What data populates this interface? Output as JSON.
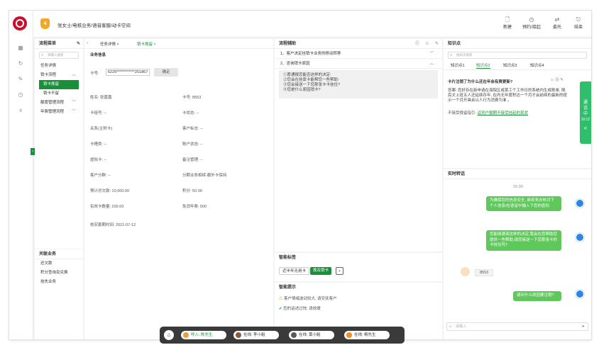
{
  "header": {
    "title": "张女士/电核业务/语音客服/动卡空间",
    "badge": "4",
    "actions": [
      {
        "label": "新建",
        "icon": "new-doc-icon"
      },
      {
        "label": "预约/接起",
        "icon": "clock-icon"
      },
      {
        "label": "委托",
        "icon": "delegate-icon"
      },
      {
        "label": "结束",
        "icon": "exit-icon"
      }
    ]
  },
  "process_menu": {
    "title": "流程菜单",
    "search_placeholder": "请输入搜索",
    "items": [
      "任务详情",
      "销卡流程",
      "销卡挽留",
      "销卡不留",
      "额度管理流程",
      "年费管理流程"
    ],
    "related_title": "关联业务",
    "related": [
      "还欠款",
      "积分查询及兑换",
      "挂失业务"
    ]
  },
  "tabs": {
    "items": [
      "任务详情",
      "销卡挽留"
    ]
  },
  "business": {
    "title": "业务信息",
    "card_label": "卡号:",
    "card_value": "6229************251867",
    "card_button": "确定",
    "fields": [
      {
        "l": "姓名: 张嘉嘉",
        "r": "卡号: 8553"
      },
      {
        "l": "卡组号: --",
        "r": "卡状态: --"
      },
      {
        "l": "关系(主附卡)",
        "r": "客户标志: --"
      },
      {
        "l": "卡槽类: --",
        "r": "账户状态: --"
      },
      {
        "l": "虚拟卡: --",
        "r": "备注管理: --"
      },
      {
        "l": "客户分群: --",
        "r": "分期业务相续-额外卡保持"
      },
      {
        "l": "预计总欠款: 10,000.00",
        "r": "积分: 50.00"
      },
      {
        "l": "有效卡数量: 200.00",
        "r": "免消年费: 500"
      }
    ],
    "expiry": "核实套期时间: 2021-07-12"
  },
  "flow": {
    "title": "流程辅助",
    "step1": "1、客户决定挂销卡业务的移动转移",
    "step2": "2、咨询销卡原因",
    "box_lines": [
      "①愿通报您能否这样的决定:",
      "②您会在挂靠卡能帮您一些帮助:",
      "③您会接送一下您那张卡卡挂住?",
      "④您是什么原因销卡?"
    ]
  },
  "tags": {
    "title": "智能标签",
    "items": [
      "近半年无用卡",
      "挽及销卡"
    ]
  },
  "tips": {
    "title": "智能提示",
    "lines": [
      "客户情绪波动较大, 请安抚客户",
      "您的话述过快, 请放缓"
    ]
  },
  "knowledge": {
    "title": "知识点",
    "search_placeholder": "搜知识搜索",
    "tabs": [
      "知识点1",
      "知识点2",
      "知识点3",
      "知识点4"
    ],
    "question": "卡片注销了为什么还在年会有费更新?",
    "answer": "答案: 您好存在新申请在海院区或某工个工作日的系统内生成账单, 随后文上班五人还延续存年, 在内无年度积达一个月才会前续的最新的提示一个月开具余以人行为消费为准 。",
    "link_label": "不接受挽留指引:",
    "link_text": "返到户额期不接受挂起的现状"
  },
  "side_tab": {
    "label": "通话中",
    "time": "10:12"
  },
  "chat": {
    "title": "实时转话",
    "time": "15:30",
    "messages": [
      "为确保您的信息安全, 麻烦来办核对下个人信息/在语音中输入下您的密码",
      "您能够通读这样的决定,我会在您帮助您提供一些帮助,请您接送一下您那张卡的卡挂住吗?",
      "请问什么原因要注销?"
    ],
    "customer_msg": "8553",
    "input_placeholder": "请输入"
  },
  "bottom": {
    "pills": [
      "呼入: 陈先生",
      "在线: 李小姐",
      "在线: 黄小姐",
      "在线: 杨先生"
    ],
    "colors": [
      "#e8a13a",
      "#8a5a3b",
      "#5a5a5a",
      "#f28c28"
    ]
  },
  "colors": {
    "accent": "#1a8f3a",
    "chat_bubble": "#5ec85a",
    "logo": "#c8102e"
  }
}
